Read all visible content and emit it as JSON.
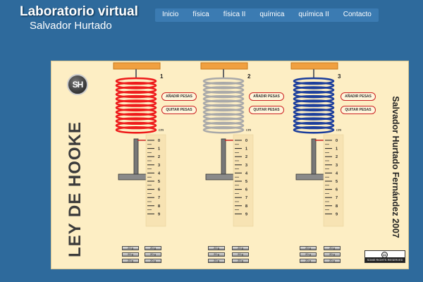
{
  "header": {
    "title": "Laboratorio virtual",
    "subtitle": "Salvador Hurtado"
  },
  "nav": {
    "items": [
      "Inicio",
      "física",
      "física II",
      "química",
      "química II",
      "Contacto"
    ]
  },
  "panel": {
    "logo": "SH",
    "title": "LEY DE HOOKE",
    "author": "Salvador Hurtado Fernández 2007",
    "license": "SOME RIGHTS RESERVED",
    "license_icon": "cc-icon",
    "springs": [
      {
        "number": "1",
        "color": "#ee1b1b",
        "add_label": "AÑADIR PESAS",
        "remove_label": "QUITAR PESAS"
      },
      {
        "number": "2",
        "color": "#a9a9a9",
        "add_label": "AÑADIR PESAS",
        "remove_label": "QUITAR PESAS"
      },
      {
        "number": "3",
        "color": "#1c3e9c",
        "add_label": "AÑADIR PESAS",
        "remove_label": "QUITAR PESAS"
      }
    ],
    "ruler": {
      "unit": "cm",
      "labels": [
        "0",
        "1",
        "2",
        "3",
        "4",
        "5",
        "6",
        "7",
        "8",
        "9"
      ]
    },
    "weight_label": "20 g"
  }
}
